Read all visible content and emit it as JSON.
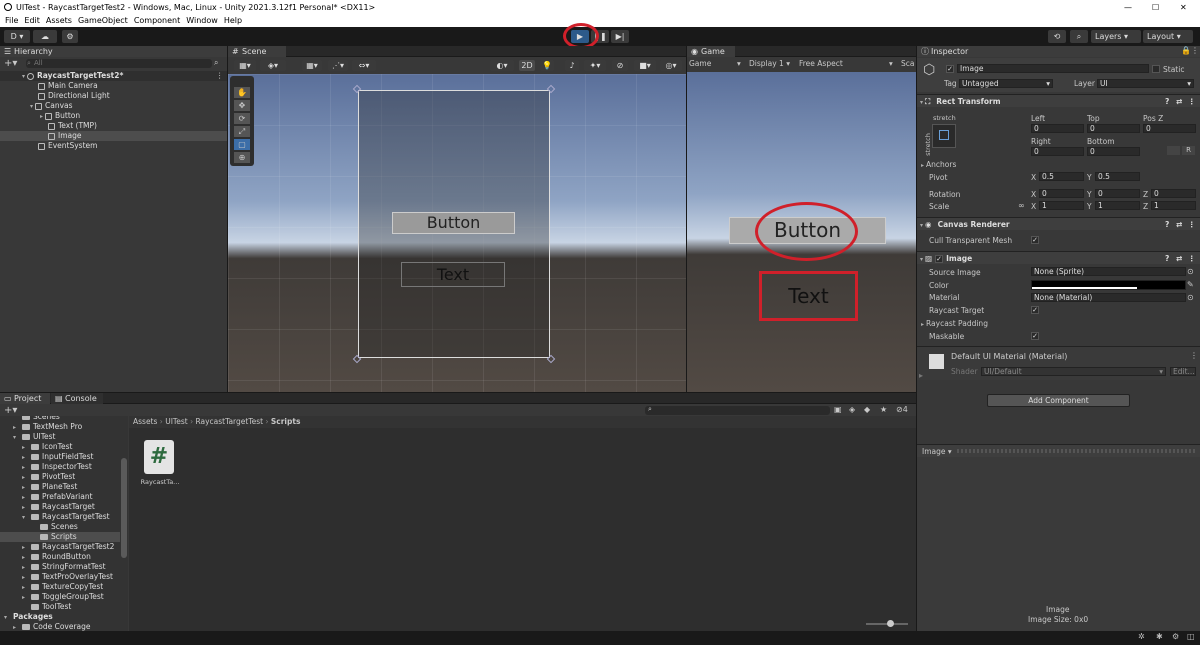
{
  "window": {
    "title": "UITest - RaycastTargetTest2 - Windows, Mac, Linux - Unity 2021.3.12f1 Personal* <DX11>"
  },
  "menu": [
    "File",
    "Edit",
    "Assets",
    "GameObject",
    "Component",
    "Window",
    "Help"
  ],
  "toolbar": {
    "account": "D",
    "layers": "Layers",
    "layout": "Layout"
  },
  "hierarchy": {
    "tab": "Hierarchy",
    "search_placeholder": "All",
    "scene": "RaycastTargetTest2*",
    "items": [
      "Main Camera",
      "Directional Light",
      "Canvas",
      "Button",
      "Text (TMP)",
      "Image",
      "EventSystem"
    ]
  },
  "scene": {
    "tab": "Scene",
    "mode_2d": "2D",
    "button_text": "Button",
    "text_text": "Text"
  },
  "game": {
    "tab": "Game",
    "view": "Game",
    "display": "Display 1",
    "aspect": "Free Aspect",
    "scale": "Sca",
    "button_text": "Button",
    "text_text": "Text"
  },
  "inspector": {
    "tab": "Inspector",
    "object_name": "Image",
    "static_label": "Static",
    "tag_label": "Tag",
    "tag_value": "Untagged",
    "layer_label": "Layer",
    "layer_value": "UI",
    "rect_transform": {
      "title": "Rect Transform",
      "stretch": "stretch",
      "stretch_v": "stretch",
      "left_label": "Left",
      "top_label": "Top",
      "posz_label": "Pos Z",
      "left": "0",
      "top": "0",
      "posz": "0",
      "right_label": "Right",
      "bottom_label": "Bottom",
      "right": "0",
      "bottom": "0",
      "anchors": "Anchors",
      "pivot": "Pivot",
      "pivot_x": "0.5",
      "pivot_y": "0.5",
      "rotation": "Rotation",
      "rot_x": "0",
      "rot_y": "0",
      "rot_z": "0",
      "scale": "Scale",
      "scale_x": "1",
      "scale_y": "1",
      "scale_z": "1",
      "x": "X",
      "y": "Y",
      "z": "Z",
      "r": "R"
    },
    "canvas_renderer": {
      "title": "Canvas Renderer",
      "cull": "Cull Transparent Mesh"
    },
    "image": {
      "title": "Image",
      "source_label": "Source Image",
      "source_value": "None (Sprite)",
      "color_label": "Color",
      "material_label": "Material",
      "material_value": "None (Material)",
      "raycast_target": "Raycast Target",
      "raycast_padding": "Raycast Padding",
      "maskable": "Maskable"
    },
    "material": {
      "name": "Default UI Material (Material)",
      "shader_label": "Shader",
      "shader_value": "UI/Default",
      "edit": "Edit..."
    },
    "add_component": "Add Component",
    "preview": {
      "title": "Image ▾",
      "name": "Image",
      "size": "Image Size: 0x0"
    }
  },
  "project": {
    "tab_project": "Project",
    "tab_console": "Console",
    "hidden_count": "4",
    "breadcrumb": [
      "Assets",
      "UITest",
      "RaycastTargetTest",
      "Scripts"
    ],
    "tree": [
      {
        "label": "Scenes",
        "depth": 1,
        "arrow": ""
      },
      {
        "label": "TextMesh Pro",
        "depth": 1,
        "arrow": "▸"
      },
      {
        "label": "UITest",
        "depth": 1,
        "arrow": "▾"
      },
      {
        "label": "IconTest",
        "depth": 2,
        "arrow": "▸"
      },
      {
        "label": "InputFieldTest",
        "depth": 2,
        "arrow": "▸"
      },
      {
        "label": "InspectorTest",
        "depth": 2,
        "arrow": "▸"
      },
      {
        "label": "PivotTest",
        "depth": 2,
        "arrow": "▸"
      },
      {
        "label": "PlaneTest",
        "depth": 2,
        "arrow": "▸"
      },
      {
        "label": "PrefabVariant",
        "depth": 2,
        "arrow": "▸"
      },
      {
        "label": "RaycastTarget",
        "depth": 2,
        "arrow": "▸"
      },
      {
        "label": "RaycastTargetTest",
        "depth": 2,
        "arrow": "▾"
      },
      {
        "label": "Scenes",
        "depth": 3,
        "arrow": ""
      },
      {
        "label": "Scripts",
        "depth": 3,
        "arrow": ""
      },
      {
        "label": "RaycastTargetTest2",
        "depth": 2,
        "arrow": "▸"
      },
      {
        "label": "RoundButton",
        "depth": 2,
        "arrow": "▸"
      },
      {
        "label": "StringFormatTest",
        "depth": 2,
        "arrow": "▸"
      },
      {
        "label": "TextProOverlayTest",
        "depth": 2,
        "arrow": "▸"
      },
      {
        "label": "TextureCopyTest",
        "depth": 2,
        "arrow": "▸"
      },
      {
        "label": "ToggleGroupTest",
        "depth": 2,
        "arrow": "▸"
      },
      {
        "label": "ToolTest",
        "depth": 2,
        "arrow": ""
      },
      {
        "label": "Packages",
        "depth": 0,
        "arrow": "▾"
      },
      {
        "label": "Code Coverage",
        "depth": 1,
        "arrow": "▸"
      }
    ],
    "asset": {
      "label": "RaycastTa...",
      "glyph": "#"
    }
  },
  "colors": {
    "annotation": "#d0202a",
    "selection": "#4d4d4d",
    "play_active": "#2d5a8a"
  }
}
